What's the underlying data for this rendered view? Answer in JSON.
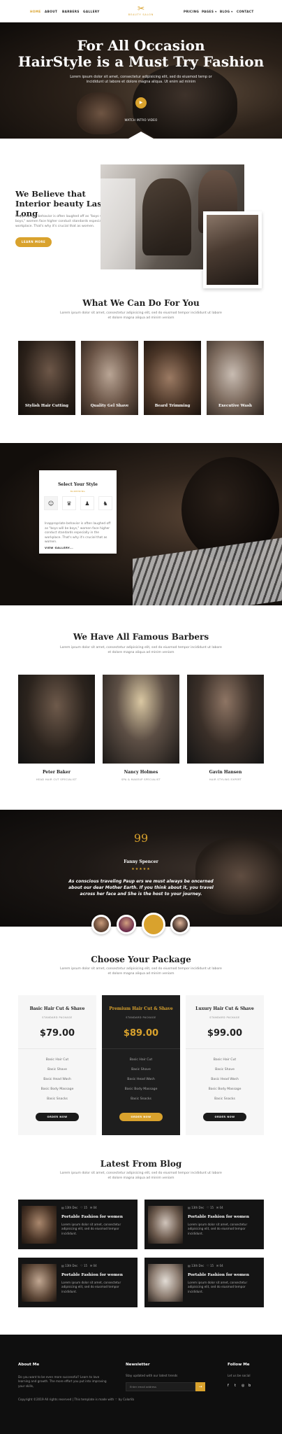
{
  "nav": {
    "left": [
      "HOME",
      "ABOUT",
      "BARBERS",
      "GALLERY"
    ],
    "right": [
      "PRICING",
      "PAGES ▾",
      "BLOG ▾",
      "CONTACT"
    ],
    "logo_text": "BEAUTY SALON"
  },
  "hero": {
    "title_line1": "For All Occasion",
    "title_line2": "HairStyle is a Must Try Fashion",
    "text": "Lorem ipsum dolor sit amet, consectetur adipisicing elit, sed do eiusmod temp or incididunt ut labore et dolore magna aliqua. Ut enim ad minim",
    "video_label": "WATCH INTRO VIDEO"
  },
  "believe": {
    "title_line1": "We Believe that",
    "title_line2": "Interior beauty Lasts Long",
    "text": "Inappropriate behavior is often laughed off as \"boys will be boys,\" women face higher conduct standards especially in the workplace. That's why it's crucial that as women.",
    "button": "LEARN MORE"
  },
  "services": {
    "title": "What We Can Do For You",
    "subtitle": "Lorem ipsum dolor sit amet, consectetur adipisicing elit, sed do eiusmod tempor incididunt ut labore et dolore magna aliqua ad minim veniam",
    "items": [
      "Stylish Hair Cutting",
      "Quality Gel Shave",
      "Beard Trimming",
      "Executive Wash"
    ]
  },
  "style": {
    "title": "Select Your Style",
    "subtitle": "BARBERING",
    "text": "Inappropriate behavior is often laughed off as \"boys will be boys,\" women face higher conduct standards especially in the workplace. That's why it's crucial that as women.",
    "link": "VIEW GALLERY..."
  },
  "barbers": {
    "title": "We Have All Famous Barbers",
    "subtitle": "Lorem ipsum dolor sit amet, consectetur adipisicing elit, sed do eiusmod tempor incididunt ut labore et dolore magna aliqua ad minim veniam",
    "items": [
      {
        "name": "Peter Baker",
        "role": "HEAD HAIR CUT SPECIALIST"
      },
      {
        "name": "Nancy Holmes",
        "role": "SPA & MAKEUP SPECIALIST"
      },
      {
        "name": "Gavin Hansen",
        "role": "HAIR STYLING EXPERT"
      }
    ]
  },
  "testimonial": {
    "quote_mark": "99",
    "name": "Fanny Spencer",
    "stars": "★★★★★",
    "text": "As conscious traveling Paup ers we must always be oncerned about our dear Mother Earth. If you think about it, you travel across her face and She is the host to your journey."
  },
  "pricing": {
    "title": "Choose Your Package",
    "subtitle": "Lorem ipsum dolor sit amet, consectetur adipisicing elit, sed do eiusmod tempor incididunt ut labore et dolore magna aliqua ad minim veniam",
    "plans": [
      {
        "name": "Basic Hair Cut & Shave",
        "tag": "STANDARD PACKAGE",
        "price": "$79.00",
        "features": [
          "Basic Hair Cut",
          "Basic Shave",
          "Basic Head Wash",
          "Basic Body Massage",
          "Basic Snacks"
        ],
        "button": "ORDER NOW"
      },
      {
        "name": "Premium Hair Cut & Shave",
        "tag": "STANDARD PACKAGE",
        "price": "$89.00",
        "features": [
          "Basic Hair Cut",
          "Basic Shave",
          "Basic Head Wash",
          "Basic Body Massage",
          "Basic Snacks"
        ],
        "button": "ORDER NOW"
      },
      {
        "name": "Luxury Hair Cut & Shave",
        "tag": "STANDARD PACKAGE",
        "price": "$99.00",
        "features": [
          "Basic Hair Cut",
          "Basic Shave",
          "Basic Head Wash",
          "Basic Body Massage",
          "Basic Snacks"
        ],
        "button": "ORDER NOW"
      }
    ]
  },
  "blog": {
    "title": "Latest From Blog",
    "subtitle": "Lorem ipsum dolor sit amet, consectetur adipisicing elit, sed do eiusmod tempor incididunt ut labore et dolore magna aliqua ad minim veniam",
    "posts": [
      {
        "date": "13th Dec",
        "likes": "15",
        "comments": "04",
        "title": "Portable Fashion for women",
        "text": "Lorem ipsum dolor sit amet, consectetur adipisicing elit, sed do eiusmod tempor incididunt."
      },
      {
        "date": "13th Dec",
        "likes": "15",
        "comments": "04",
        "title": "Portable Fashion for women",
        "text": "Lorem ipsum dolor sit amet, consectetur adipisicing elit, sed do eiusmod tempor incididunt."
      },
      {
        "date": "13th Dec",
        "likes": "15",
        "comments": "04",
        "title": "Portable Fashion for women",
        "text": "Lorem ipsum dolor sit amet, consectetur adipisicing elit, sed do eiusmod tempor incididunt."
      },
      {
        "date": "13th Dec",
        "likes": "15",
        "comments": "04",
        "title": "Portable Fashion for women",
        "text": "Lorem ipsum dolor sit amet, consectetur adipisicing elit, sed do eiusmod tempor incididunt."
      }
    ]
  },
  "footer": {
    "about_title": "About Me",
    "about_text": "Do you want to be even more successful? Learn to love learning and growth. The more effort you put into improving your skills,",
    "copyright": "Copyright ©2019 All rights reserved | This template is made with ♡ by Colorlib",
    "newsletter_title": "Newsletter",
    "newsletter_text": "Stay updated with our latest trends",
    "newsletter_placeholder": "Enter email address",
    "follow_title": "Follow Me",
    "follow_text": "Let us be social"
  },
  "colors": {
    "accent": "#d9a22d",
    "dark": "#141414"
  }
}
